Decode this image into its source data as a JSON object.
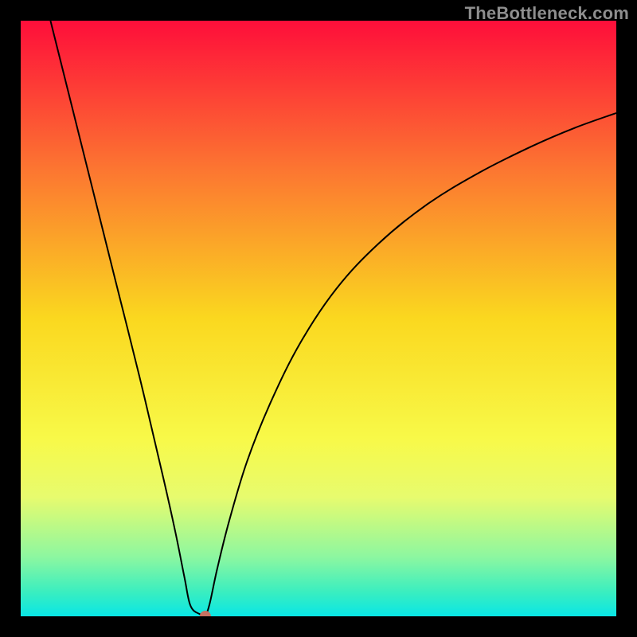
{
  "watermark": "TheBottleneck.com",
  "chart_data": {
    "type": "line",
    "title": "",
    "xlabel": "",
    "ylabel": "",
    "xlim": [
      0,
      100
    ],
    "ylim": [
      0,
      100
    ],
    "optimum_x": 30,
    "marker": {
      "x": 31,
      "y": 0,
      "color": "#c77262",
      "radius": 7
    },
    "background": {
      "type": "vertical-gradient",
      "stops": [
        {
          "offset": 0.0,
          "color": "#fe0e3a"
        },
        {
          "offset": 0.25,
          "color": "#fc7631"
        },
        {
          "offset": 0.5,
          "color": "#fad81f"
        },
        {
          "offset": 0.7,
          "color": "#f8f948"
        },
        {
          "offset": 0.8,
          "color": "#e7fb6e"
        },
        {
          "offset": 0.9,
          "color": "#8df7a0"
        },
        {
          "offset": 0.96,
          "color": "#39eec0"
        },
        {
          "offset": 1.0,
          "color": "#09e6e6"
        }
      ]
    },
    "curve_description": "V-shaped bottleneck curve. Left branch is near-linear from (5,100) down to the flat minimum around x=28..31 at y≈0. Right branch rises with decreasing slope toward (100, ~85).",
    "series": [
      {
        "name": "bottleneck",
        "color": "#000000",
        "stroke_width": 2,
        "x": [
          5,
          8,
          12,
          16,
          20,
          24,
          26,
          27.5,
          28.5,
          30,
          31.0,
          31.7,
          33,
          35,
          38,
          42,
          47,
          53,
          60,
          68,
          77,
          86,
          93,
          100
        ],
        "y": [
          100,
          88,
          72,
          56,
          40,
          23,
          14,
          6.5,
          1.8,
          0.4,
          0.4,
          2.0,
          8,
          16,
          26,
          36,
          46,
          55,
          62.5,
          69,
          74.5,
          79,
          82,
          84.5
        ]
      }
    ]
  }
}
